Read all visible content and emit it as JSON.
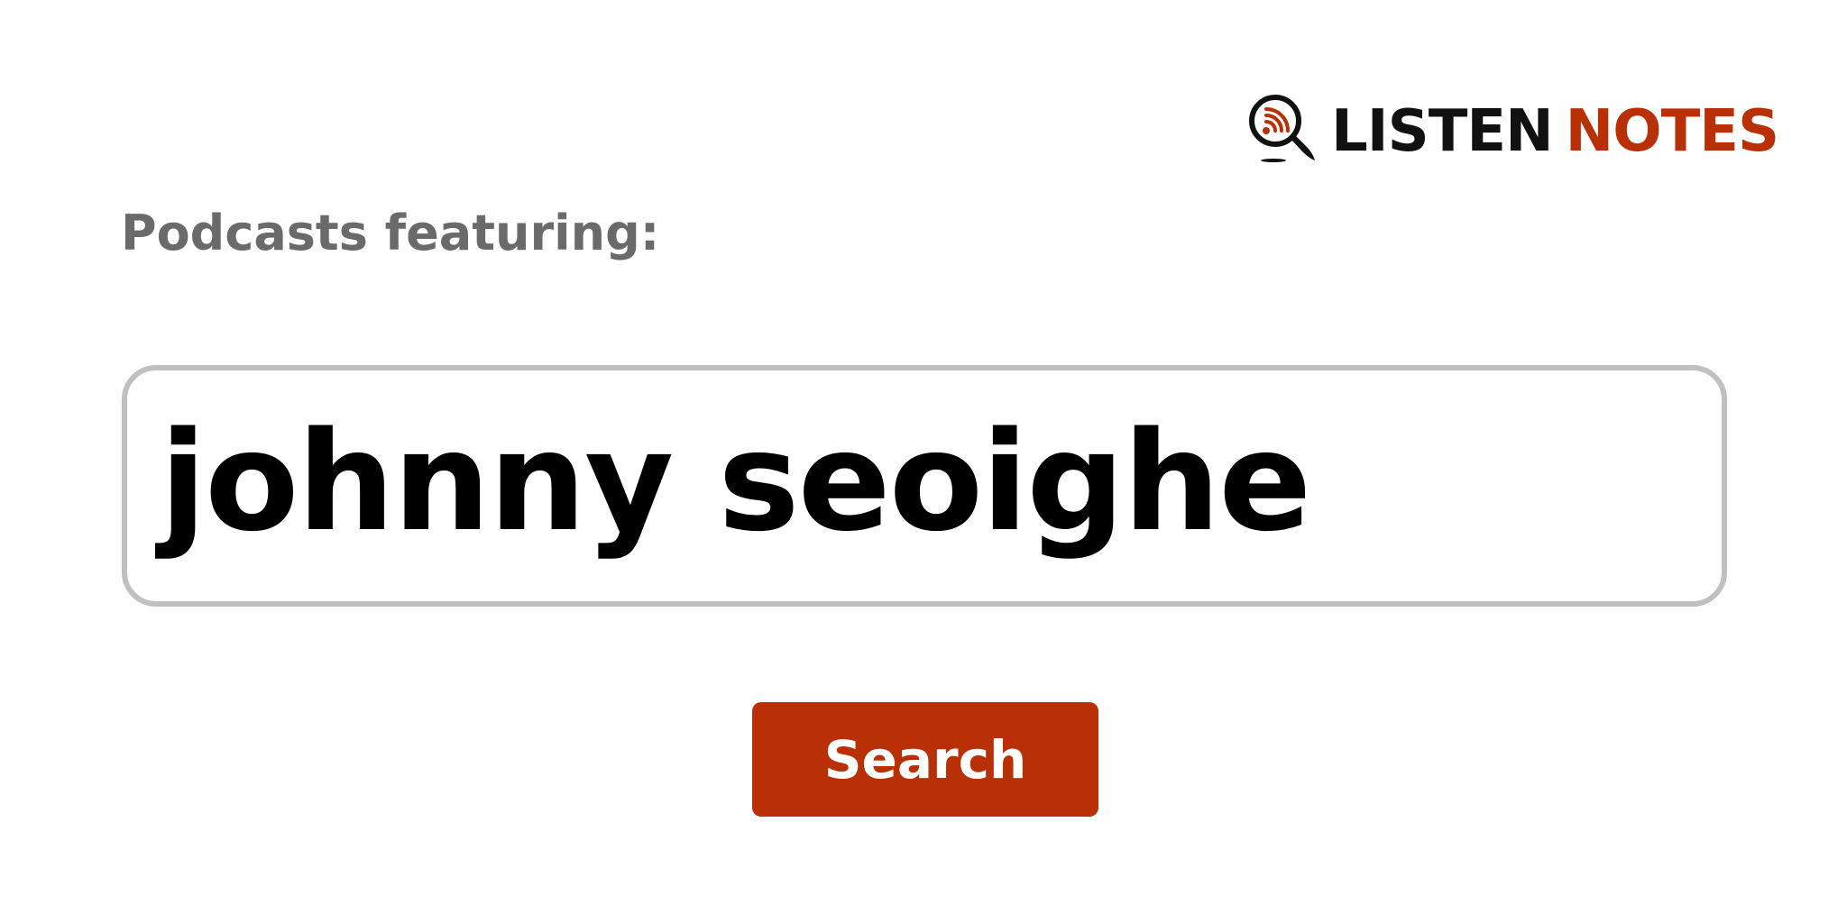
{
  "logo": {
    "word_primary": "LISTEN",
    "word_accent": "NOTES",
    "icon": "magnifier-podcast-icon"
  },
  "heading": {
    "text": "Podcasts featuring:"
  },
  "search": {
    "value": "johnny seoighe"
  },
  "button": {
    "label": "Search"
  },
  "colors": {
    "brand": "#b93007",
    "heading": "#6a6a6a",
    "field_border": "#c0c0c0",
    "text": "#000000"
  }
}
